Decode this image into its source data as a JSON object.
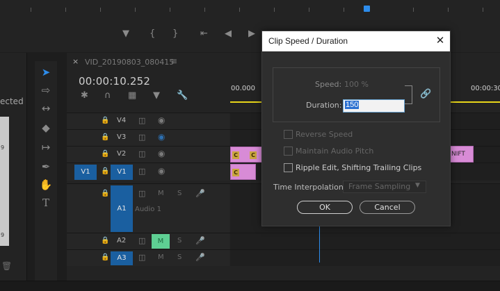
{
  "colors": {
    "accent_blue": "#2d8ceb",
    "track_target_blue": "#1a5fa0",
    "clip_pink": "#d88bd6",
    "fx_badge": "#caa640",
    "ruler_yellow": "#e8d619",
    "audio_mute_green": "#5ecf93",
    "dialog_bg": "#2e2e2e",
    "input_selection": "#2a6fd0"
  },
  "project_panel": {
    "label_fragment": "ected",
    "thumb_num_top": "9",
    "thumb_num_bottom": "9"
  },
  "sequence": {
    "tab_name": "VID_20190803_080415",
    "timecode": "00:00:10.252",
    "ruler_labels": [
      "00.000",
      "00:00:30"
    ]
  },
  "tracks": {
    "video": [
      {
        "name": "V4"
      },
      {
        "name": "V3"
      },
      {
        "name": "V2"
      },
      {
        "name": "V1",
        "source": "V1"
      }
    ],
    "audio": [
      {
        "name": "A1",
        "label": "Audio 1",
        "m": "M",
        "s": "S"
      },
      {
        "name": "A2",
        "m": "M",
        "s": "S"
      },
      {
        "name": "A3",
        "m": "M",
        "s": "S"
      }
    ]
  },
  "clips": {
    "fx_letter": "C",
    "shifted_clip_label": "NIFT"
  },
  "dialog": {
    "title": "Clip Speed / Duration",
    "speed_label": "Speed:",
    "speed_value": "100 %",
    "duration_label": "Duration:",
    "duration_value": "150",
    "checkboxes": [
      {
        "label": "Reverse Speed",
        "checked": false,
        "enabled": false
      },
      {
        "label": "Maintain Audio Pitch",
        "checked": false,
        "enabled": false
      },
      {
        "label": "Ripple Edit, Shifting Trailing Clips",
        "checked": false,
        "enabled": true
      }
    ],
    "interpolation_label": "Time Interpolation:",
    "interpolation_value": "Frame Sampling",
    "ok_label": "OK",
    "cancel_label": "Cancel"
  },
  "icons": {
    "transport": [
      "marker-icon",
      "in-point-icon",
      "out-point-icon",
      "go-to-in-icon",
      "step-back-icon",
      "play-icon"
    ],
    "tools": [
      "selection-tool-icon",
      "track-select-icon",
      "ripple-edit-icon",
      "razor-icon",
      "slip-icon",
      "pen-icon",
      "hand-icon",
      "type-icon"
    ],
    "timeline_tools": [
      "snap-icon",
      "magnet-icon",
      "linked-selection-icon",
      "add-marker-icon",
      "wrench-icon"
    ]
  }
}
